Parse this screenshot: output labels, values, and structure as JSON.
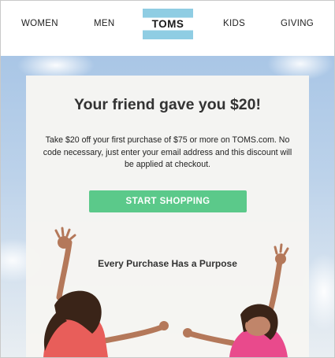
{
  "nav": {
    "items": [
      {
        "label": "WOMEN"
      },
      {
        "label": "MEN"
      },
      {
        "label": "KIDS"
      },
      {
        "label": "GIVING"
      }
    ],
    "logo_text": "TOMS"
  },
  "promo": {
    "headline": "Your friend gave you $20!",
    "body": "Take $20 off your first purchase of $75 or more on TOMS.com. No code necessary, just enter your email address and this discount will be applied at checkout.",
    "cta_label": "START SHOPPING",
    "tagline": "Every Purchase Has a Purpose"
  },
  "colors": {
    "cta": "#5bc98a",
    "logo_stripe": "#8fcde3",
    "sky": "#a9c6e6"
  }
}
